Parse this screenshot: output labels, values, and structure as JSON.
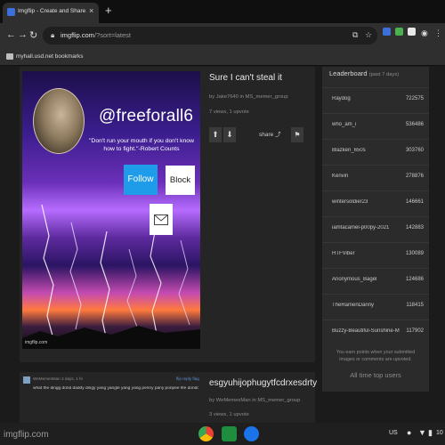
{
  "browser": {
    "tab_title": "Imgflip - Create and Share Awesome Images",
    "tab_close": "×",
    "new_tab": "+",
    "url_host": "imgflip.com",
    "url_path": "/?sort=latest",
    "bookmarks_label": "myhall.usd.net bookmarks",
    "nav": {
      "back": "←",
      "forward": "→",
      "reload": "↻"
    }
  },
  "post1": {
    "title": "Sure I can't steal it",
    "meta": "by Jake7640 in MS_memer_group",
    "stats": "7 views, 1 upvote",
    "share_label": "share",
    "meme": {
      "handle": "@freeforall6",
      "quote": "\"Don't run your mouth if you don't know how to fight.\"-Robert Counts",
      "follow_label": "Follow",
      "block_label": "Block",
      "watermark": "imgflip.com"
    }
  },
  "post2": {
    "title": "esgyuhijophugytfcdrxesdrty",
    "meta": "by WeMemesMan in MS_memer_group",
    "stats": "3 views, 1 upvote",
    "comment": {
      "user": "WeMemesMan   2 days, 1 hr",
      "reply": "flip  reply  flag",
      "text": "what the dingg dond daddy dingy yang yangle yang yang penny pany ponpee fife dondonnie"
    }
  },
  "leaderboard": {
    "title": "Leaderboard",
    "period": "(past 7 days)",
    "entries": [
      {
        "name": "Raydog",
        "points": "722575"
      },
      {
        "name": "who_am_i",
        "points": "536486"
      },
      {
        "name": "Blazken_650s",
        "points": "303760"
      },
      {
        "name": "Kenvin",
        "points": "278876"
      },
      {
        "name": "wintersoldier23",
        "points": "146661"
      },
      {
        "name": "iamtacamel-p00py-2021",
        "points": "142883"
      },
      {
        "name": "HTFViber",
        "points": "130089"
      },
      {
        "name": "Anonymous_Bagel",
        "points": "124686"
      },
      {
        "name": "TheRamenDanny",
        "points": "118415"
      },
      {
        "name": "Buzzy-Beautiful-Sunshine-Magic",
        "points": "117902"
      }
    ],
    "note": "You earn points when your submitted images or comments are upvoted.",
    "link": "All time top users"
  },
  "taskbar": {
    "brand": "imgflip.com",
    "locale": "US",
    "time": "10"
  },
  "colors": {
    "follow": "#1e9be9",
    "accent_link": "#5d8fd6"
  }
}
